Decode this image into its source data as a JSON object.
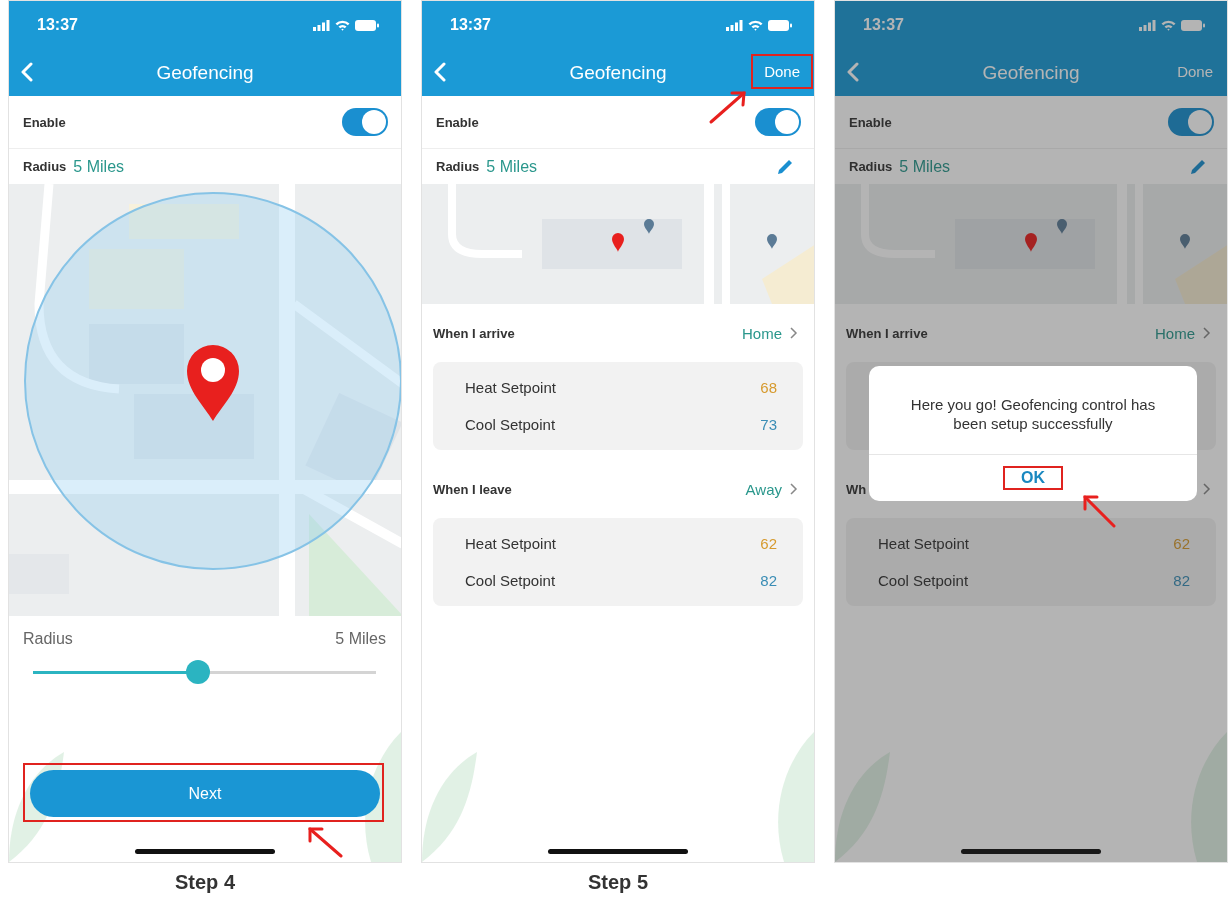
{
  "screens": [
    {
      "kind": "radius",
      "status_time": "13:37",
      "title": "Geofencing",
      "enable": {
        "label": "Enable",
        "on": true
      },
      "radius": {
        "label": "Radius",
        "value": "5 Miles"
      },
      "slider": {
        "label": "Radius",
        "reading": "5 Miles",
        "level": 0.48
      },
      "next_button": {
        "label": "Next",
        "highlighted": true
      },
      "caption": "Step 4"
    },
    {
      "kind": "summary",
      "status_time": "13:37",
      "title": "Geofencing",
      "done_button": {
        "label": "Done",
        "highlighted": true
      },
      "enable": {
        "label": "Enable",
        "on": true
      },
      "radius": {
        "label": "Radius",
        "value": "5 Miles",
        "editable": true
      },
      "sections": [
        {
          "title": "When I arrive",
          "mode": "Home",
          "rows": [
            {
              "kind": "heat",
              "label": "Heat Setpoint",
              "value": "68"
            },
            {
              "kind": "cool",
              "label": "Cool Setpoint",
              "value": "73"
            }
          ]
        },
        {
          "title": "When I leave",
          "mode": "Away",
          "rows": [
            {
              "kind": "heat",
              "label": "Heat Setpoint",
              "value": "62"
            },
            {
              "kind": "cool",
              "label": "Cool Setpoint",
              "value": "82"
            }
          ]
        }
      ],
      "caption": "Step 5"
    },
    {
      "kind": "summary",
      "status_time": "13:37",
      "title": "Geofencing",
      "done_button": {
        "label": "Done"
      },
      "enable": {
        "label": "Enable",
        "on": true
      },
      "radius": {
        "label": "Radius",
        "value": "5 Miles",
        "editable": true
      },
      "sections": [
        {
          "title": "When I arrive",
          "mode": "Home"
        },
        {
          "title": "Wh",
          "rows": [
            {
              "kind": "heat",
              "label": "Heat Setpoint",
              "value": "62"
            },
            {
              "kind": "cool",
              "label": "Cool Setpoint",
              "value": "82"
            }
          ]
        }
      ],
      "dialog": {
        "message": "Here you go! Geofencing control has been setup successfully",
        "ok_button": {
          "label": "OK",
          "highlighted": true
        }
      }
    }
  ]
}
